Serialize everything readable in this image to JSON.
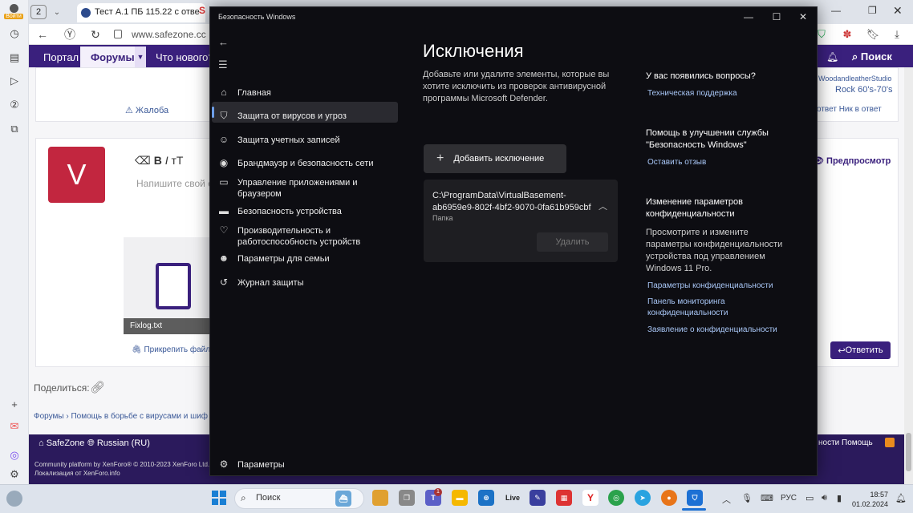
{
  "browser": {
    "login_label": "Войти",
    "tab_count": "2",
    "tab1_title": "Тест А.1 ПБ 115.22 с отве",
    "tab2_title": "S",
    "url": "www.safezone.cc"
  },
  "site_nav": {
    "portal": "Портал",
    "forums": "Форумы",
    "whats_new": "Что нового?",
    "search": "Поиск"
  },
  "page": {
    "complaint": "Жалоба",
    "avatar_letter": "V",
    "editor_placeholder": "Напишите свой о",
    "preview": "Предпросмотр",
    "reply": "Ответить",
    "woodland": "WoodandleatherStudio",
    "rock": "Rock 60's-70's",
    "twocols": "ответ      Ник в ответ",
    "fixlog": "Fixlog.txt",
    "attach": "Прикрепить файл",
    "share": "Поделиться:",
    "breadcrumbs": "Форумы  ›  Помощь в борьбе с вирусами и шиф"
  },
  "footer": {
    "safezone": "SafeZone",
    "lang": "Russian (RU)",
    "credit": "Community platform by XenForo® © 2010-2023 XenForo Ltd.",
    "localization": "Локализация от XenForo.info",
    "right_links": "ности   Помощь"
  },
  "ws": {
    "title": "Безопасность Windows",
    "nav": [
      {
        "icon": "home-icon",
        "glyph": "⌂",
        "label": "Главная"
      },
      {
        "icon": "shield-icon",
        "glyph": "⛉",
        "label": "Защита от вирусов и угроз"
      },
      {
        "icon": "person-icon",
        "glyph": "☺",
        "label": "Защита учетных записей"
      },
      {
        "icon": "wifi-icon",
        "glyph": "◉",
        "label": "Брандмауэр и безопасность сети"
      },
      {
        "icon": "app-browser-icon",
        "glyph": "▭",
        "label": "Управление приложениями и браузером"
      },
      {
        "icon": "laptop-icon",
        "glyph": "▬",
        "label": "Безопасность устройства"
      },
      {
        "icon": "heart-icon",
        "glyph": "♡",
        "label": "Производительность и работоспособность устройств"
      },
      {
        "icon": "family-icon",
        "glyph": "☻",
        "label": "Параметры для семьи"
      },
      {
        "icon": "history-icon",
        "glyph": "↺",
        "label": "Журнал защиты"
      }
    ],
    "settings": "Параметры",
    "heading": "Исключения",
    "description": "Добавьте или удалите элементы, которые вы хотите исключить из проверок антивирусной программы Microsoft Defender.",
    "add_button": "Добавить исключение",
    "exclusion": {
      "path": "C:\\ProgramData\\VirtualBasement-ab6959e9-802f-4bf2-9070-0fa61b959cbf",
      "type": "Папка",
      "delete": "Удалить"
    },
    "right": {
      "questions_h": "У вас появились вопросы?",
      "support": "Техническая поддержка",
      "improve_h": "Помощь в улучшении службы \"Безопасность Windows\"",
      "feedback": "Оставить отзыв",
      "privacy_h": "Изменение параметров конфиденциальности",
      "privacy_p": "Просмотрите и измените параметры конфиденциальности устройства под управлением Windows 11 Pro.",
      "privacy_settings": "Параметры конфиденциальности",
      "privacy_dashboard": "Панель мониторинга конфиденциальности",
      "privacy_statement": "Заявление о конфиденциальности"
    }
  },
  "taskbar": {
    "search": "Поиск",
    "lang": "РУС",
    "time": "18:57",
    "date": "01.02.2024",
    "badge": "1",
    "live": "Live"
  }
}
